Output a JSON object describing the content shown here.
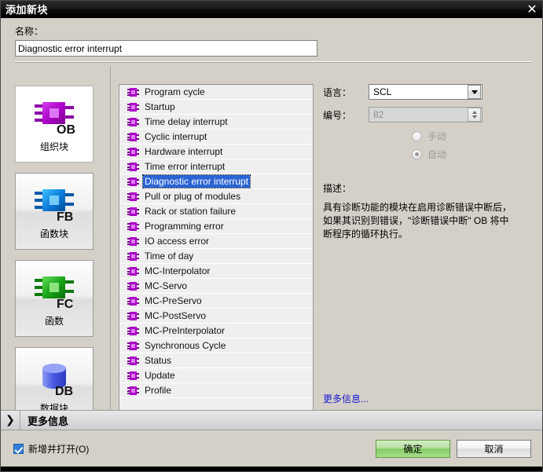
{
  "window": {
    "title": "添加新块",
    "close_icon": "close-icon"
  },
  "name_field": {
    "label": "名称：",
    "value": "Diagnostic error interrupt"
  },
  "block_types": [
    {
      "caption": "组织块",
      "badge": "OB",
      "color": "#b200c8",
      "selected": true
    },
    {
      "caption": "函数块",
      "badge": "FB",
      "color": "#0a78d6",
      "selected": false
    },
    {
      "caption": "函数",
      "badge": "FC",
      "color": "#16a016",
      "selected": false
    },
    {
      "caption": "数据块",
      "badge": "DB",
      "color": "#4f5fe0",
      "selected": false
    }
  ],
  "block_list": [
    {
      "label": "Program cycle",
      "selected": false
    },
    {
      "label": "Startup",
      "selected": false
    },
    {
      "label": "Time delay interrupt",
      "selected": false
    },
    {
      "label": "Cyclic interrupt",
      "selected": false
    },
    {
      "label": "Hardware interrupt",
      "selected": false
    },
    {
      "label": "Time error interrupt",
      "selected": false
    },
    {
      "label": "Diagnostic error interrupt",
      "selected": true
    },
    {
      "label": "Pull or plug of modules",
      "selected": false
    },
    {
      "label": "Rack or station failure",
      "selected": false
    },
    {
      "label": "Programming error",
      "selected": false
    },
    {
      "label": "IO access error",
      "selected": false
    },
    {
      "label": "Time of day",
      "selected": false
    },
    {
      "label": "MC-Interpolator",
      "selected": false
    },
    {
      "label": "MC-Servo",
      "selected": false
    },
    {
      "label": "MC-PreServo",
      "selected": false
    },
    {
      "label": "MC-PostServo",
      "selected": false
    },
    {
      "label": "MC-PreInterpolator",
      "selected": false
    },
    {
      "label": "Synchronous Cycle",
      "selected": false
    },
    {
      "label": "Status",
      "selected": false
    },
    {
      "label": "Update",
      "selected": false
    },
    {
      "label": "Profile",
      "selected": false
    }
  ],
  "properties": {
    "language_label": "语言：",
    "language_value": "SCL",
    "number_label": "编号：",
    "number_value": "82",
    "radio_manual": "手动",
    "radio_auto": "自动"
  },
  "description": {
    "label": "描述：",
    "text": "具有诊断功能的模块在启用诊断错误中断后，如果其识别到错误，\"诊断错误中断\" OB 将中断程序的循环执行。"
  },
  "more_info_link": "更多信息...",
  "expander": {
    "chevron": "❯",
    "label": "更多信息"
  },
  "footer": {
    "open_checkbox_label": "新增并打开(O)",
    "ok_label": "确定",
    "cancel_label": "取消"
  }
}
